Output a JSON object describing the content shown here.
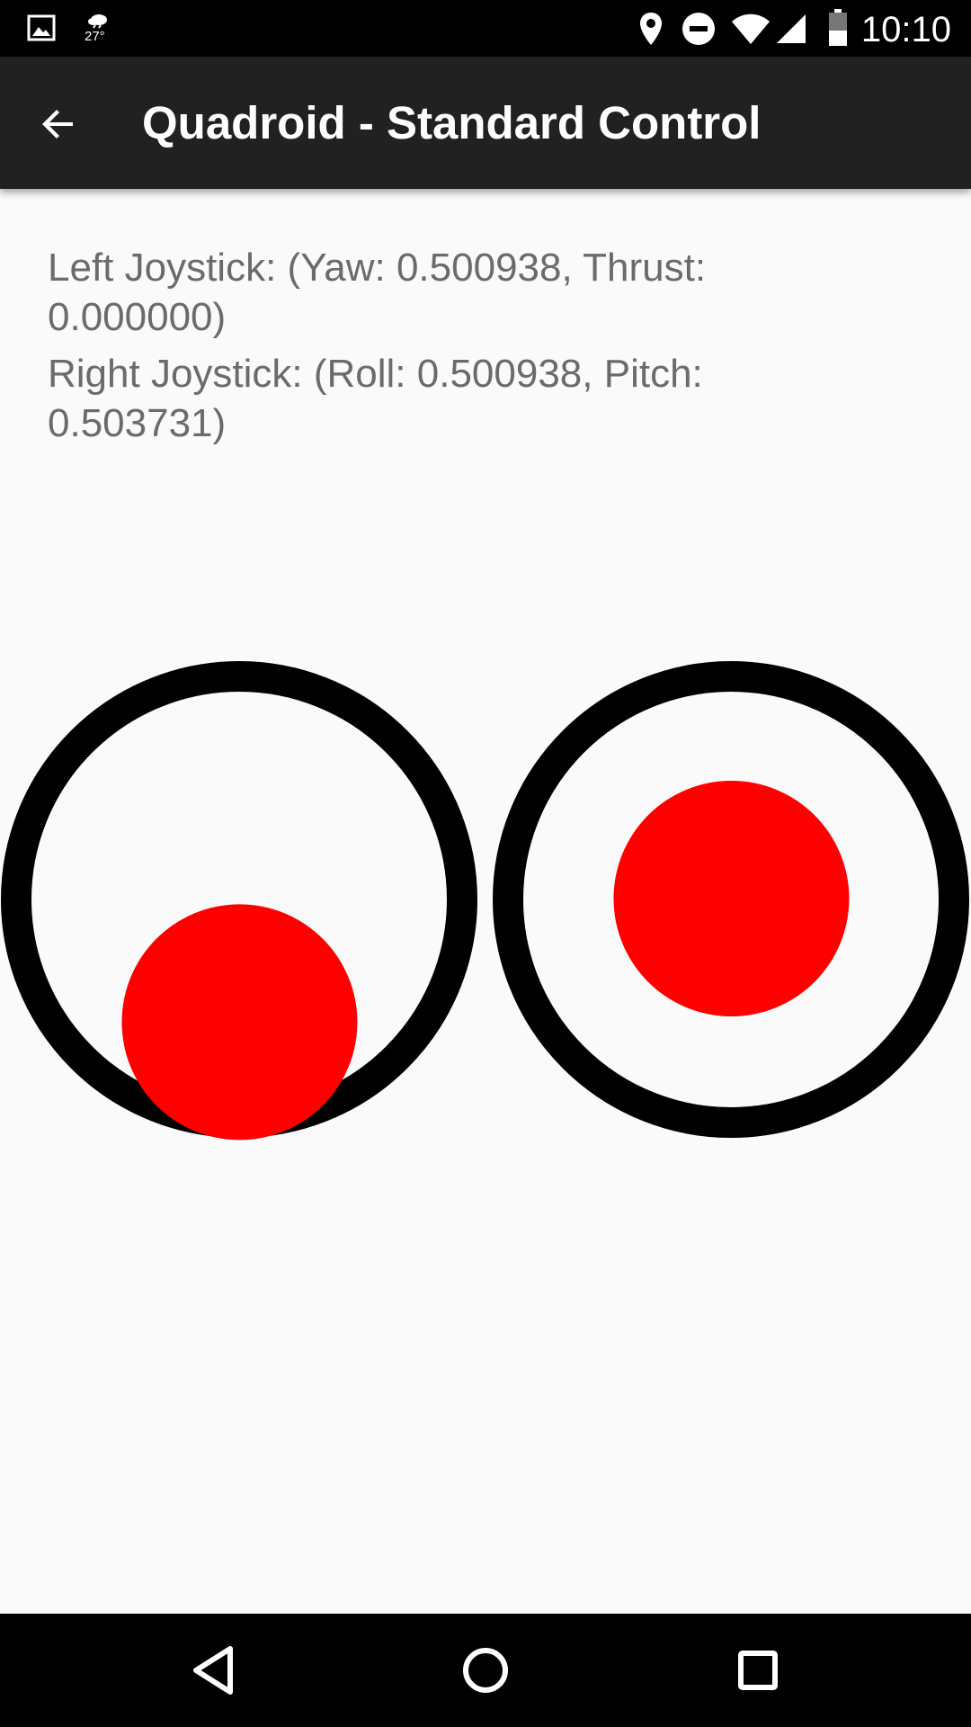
{
  "status_bar": {
    "temperature": "27°",
    "time": "10:10",
    "icons": [
      "gallery-icon",
      "weather-icon",
      "location-icon",
      "do-not-disturb-icon",
      "wifi-icon",
      "cell-signal-icon",
      "battery-icon"
    ]
  },
  "app_bar": {
    "title": "Quadroid - Standard Control",
    "back_icon": "arrow-back-icon"
  },
  "readouts": {
    "left": "Left Joystick: (Yaw: 0.500938, Thrust: 0.000000)",
    "right": "Right Joystick: (Roll: 0.500938, Pitch: 0.503731)"
  },
  "joysticks": {
    "left": {
      "yaw": 0.500938,
      "thrust": 0.0
    },
    "right": {
      "roll": 0.500938,
      "pitch": 0.503731
    },
    "ring_color": "#000000",
    "knob_color": "#ff0000"
  },
  "nav_bar": {
    "icons": [
      "back-triangle-icon",
      "home-circle-icon",
      "recents-square-icon"
    ]
  }
}
